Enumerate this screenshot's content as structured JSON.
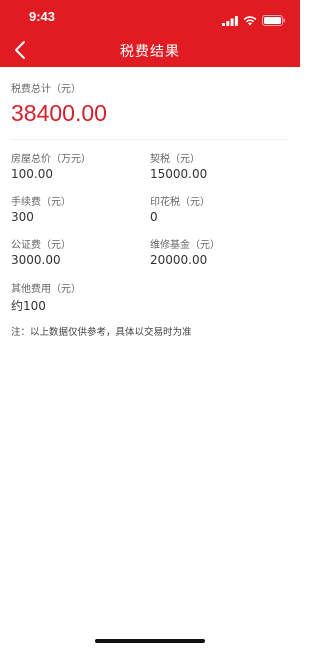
{
  "status_bar": {
    "time": "9:43"
  },
  "nav": {
    "title": "税费结果"
  },
  "total": {
    "label": "税费总计（元）",
    "value": "38400.00"
  },
  "items": [
    {
      "label": "房屋总价（万元）",
      "value": "100.00"
    },
    {
      "label": "契税（元）",
      "value": "15000.00"
    },
    {
      "label": "手续费（元）",
      "value": "300"
    },
    {
      "label": "印花税（元）",
      "value": "0"
    },
    {
      "label": "公证费（元）",
      "value": "3000.00"
    },
    {
      "label": "维修基金（元）",
      "value": "20000.00"
    },
    {
      "label": "其他费用（元）",
      "value": "约100"
    }
  ],
  "note": "注：以上数据仅供参考，具体以交易时为准",
  "colors": {
    "header": "#e01b22",
    "total": "#d6202a"
  }
}
